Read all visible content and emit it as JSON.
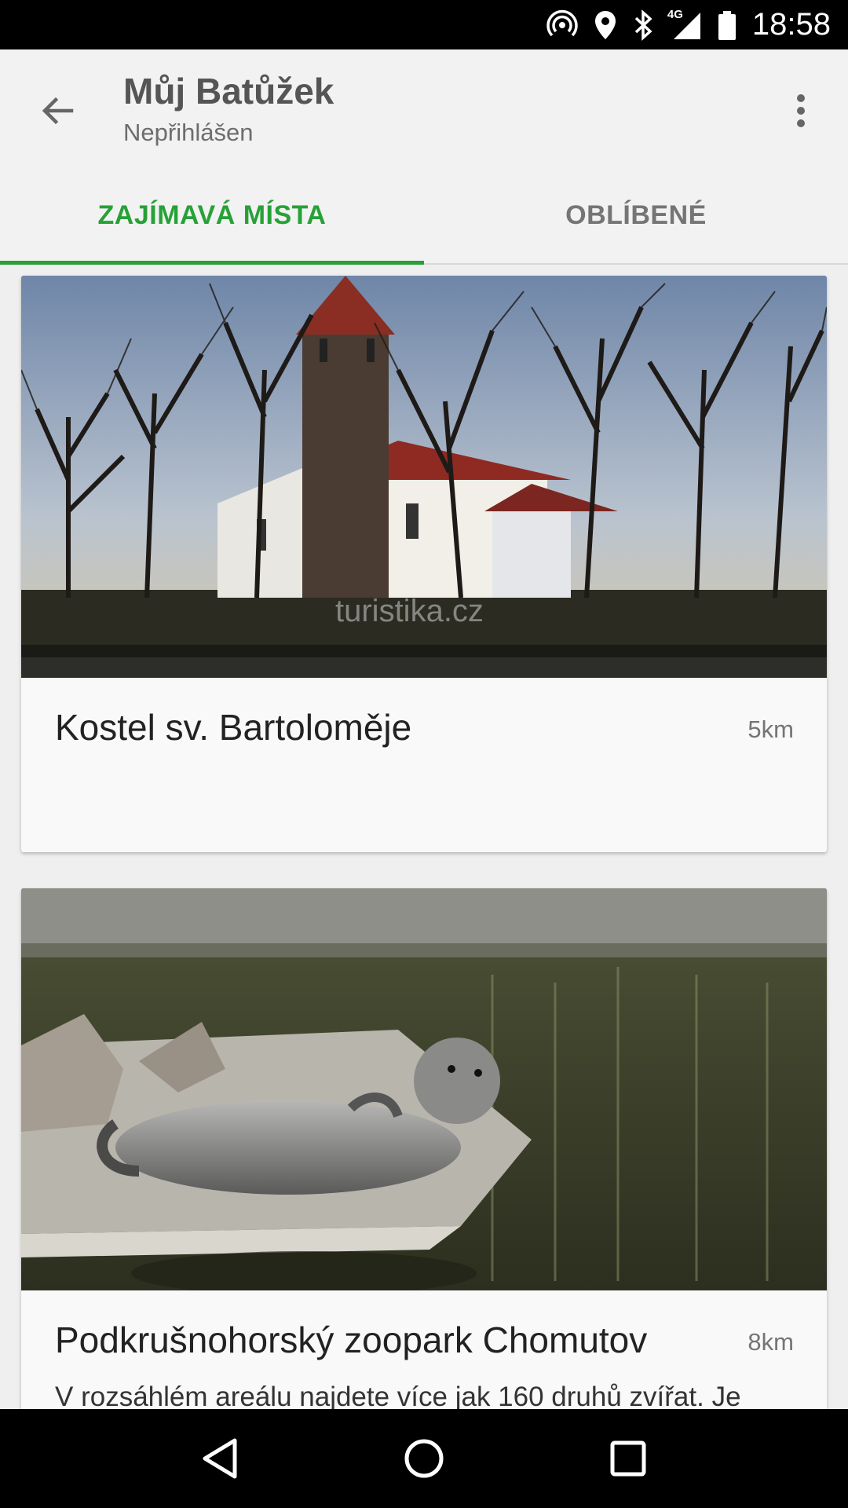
{
  "status_bar": {
    "time": "18:58",
    "network": "4G",
    "icons": [
      "hotspot-icon",
      "location-icon",
      "bluetooth-icon",
      "signal-icon",
      "battery-icon"
    ]
  },
  "app_bar": {
    "title": "Můj Batůžek",
    "subtitle": "Nepřihlášen",
    "back_icon": "arrow-back-icon",
    "menu_icon": "more-vert-icon"
  },
  "tabs": [
    {
      "label": "ZAJÍMAVÁ MÍSTA",
      "active": true
    },
    {
      "label": "OBLÍBENÉ",
      "active": false
    }
  ],
  "colors": {
    "accent": "#27a137",
    "background": "#efefef",
    "card": "#f9f9f9"
  },
  "places": [
    {
      "title": "Kostel sv. Bartoloměje",
      "distance": "5km",
      "description": "",
      "image": "church with bare trees photo",
      "watermark": "turistika.cz"
    },
    {
      "title": "Podkrušnohorský zoopark Chomutov",
      "distance": "8km",
      "description": "V rozsáhlém areálu najdete více jak  160 druhů zvířat. Je",
      "image": "seal lying on rock by water photo"
    }
  ],
  "nav_bar": {
    "icons": [
      "back-triangle-icon",
      "home-circle-icon",
      "recents-square-icon"
    ]
  }
}
